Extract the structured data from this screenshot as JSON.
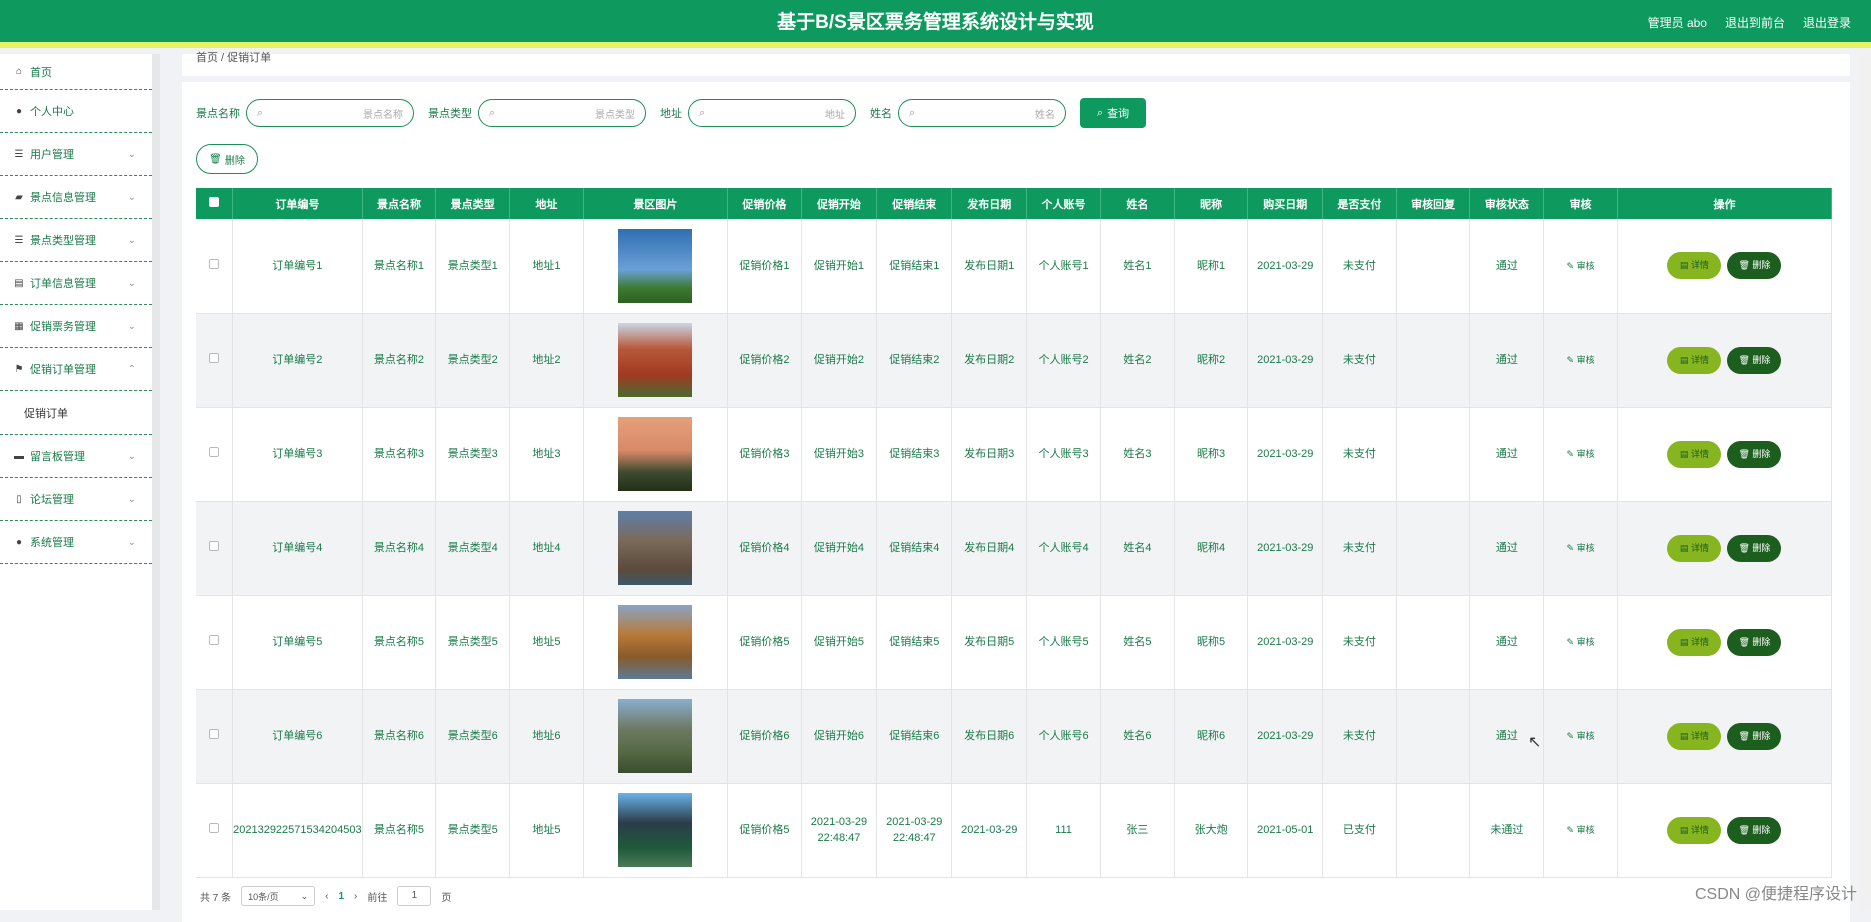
{
  "header": {
    "title": "基于B/S景区票务管理系统设计与实现",
    "admin": "管理员 abo",
    "front": "退出到前台",
    "logout": "退出登录"
  },
  "sidebar": {
    "items": [
      {
        "label": "首页",
        "icon": "home-icon"
      },
      {
        "label": "个人中心",
        "icon": "user-icon"
      },
      {
        "label": "用户管理",
        "icon": "list-icon"
      },
      {
        "label": "景点信息管理",
        "icon": "camera-icon"
      },
      {
        "label": "景点类型管理",
        "icon": "list-icon"
      },
      {
        "label": "订单信息管理",
        "icon": "printer-icon"
      },
      {
        "label": "促销票务管理",
        "icon": "clipboard-icon"
      },
      {
        "label": "促销订单管理",
        "icon": "flag-icon"
      },
      {
        "label": "留言板管理",
        "icon": "monitor-icon"
      },
      {
        "label": "论坛管理",
        "icon": "forum-icon"
      },
      {
        "label": "系统管理",
        "icon": "user-icon"
      }
    ],
    "submenu": "促销订单"
  },
  "breadcrumb": "首页 / 促销订单",
  "search": {
    "fields": [
      {
        "label": "景点名称",
        "placeholder": "景点名称"
      },
      {
        "label": "景点类型",
        "placeholder": "景点类型"
      },
      {
        "label": "地址",
        "placeholder": "地址"
      },
      {
        "label": "姓名",
        "placeholder": "姓名"
      }
    ],
    "query": "查询",
    "delete": "删除"
  },
  "table": {
    "columns": [
      "订单编号",
      "景点名称",
      "景点类型",
      "地址",
      "景区图片",
      "促销价格",
      "促销开始",
      "促销结束",
      "发布日期",
      "个人账号",
      "姓名",
      "昵称",
      "购买日期",
      "是否支付",
      "审核回复",
      "审核状态",
      "审核",
      "操作"
    ],
    "rows": [
      {
        "c0": "订单编号1",
        "c1": "景点名称1",
        "c2": "景点类型1",
        "c3": "地址1",
        "c5": "促销价格1",
        "c6": "促销开始1",
        "c7": "促销结束1",
        "c8": "发布日期1",
        "c9": "个人账号1",
        "c10": "姓名1",
        "c11": "昵称1",
        "c12": "2021-03-29",
        "c13": "未支付",
        "c14": "",
        "c15": "通过"
      },
      {
        "c0": "订单编号2",
        "c1": "景点名称2",
        "c2": "景点类型2",
        "c3": "地址2",
        "c5": "促销价格2",
        "c6": "促销开始2",
        "c7": "促销结束2",
        "c8": "发布日期2",
        "c9": "个人账号2",
        "c10": "姓名2",
        "c11": "昵称2",
        "c12": "2021-03-29",
        "c13": "未支付",
        "c14": "",
        "c15": "通过"
      },
      {
        "c0": "订单编号3",
        "c1": "景点名称3",
        "c2": "景点类型3",
        "c3": "地址3",
        "c5": "促销价格3",
        "c6": "促销开始3",
        "c7": "促销结束3",
        "c8": "发布日期3",
        "c9": "个人账号3",
        "c10": "姓名3",
        "c11": "昵称3",
        "c12": "2021-03-29",
        "c13": "未支付",
        "c14": "",
        "c15": "通过"
      },
      {
        "c0": "订单编号4",
        "c1": "景点名称4",
        "c2": "景点类型4",
        "c3": "地址4",
        "c5": "促销价格4",
        "c6": "促销开始4",
        "c7": "促销结束4",
        "c8": "发布日期4",
        "c9": "个人账号4",
        "c10": "姓名4",
        "c11": "昵称4",
        "c12": "2021-03-29",
        "c13": "未支付",
        "c14": "",
        "c15": "通过"
      },
      {
        "c0": "订单编号5",
        "c1": "景点名称5",
        "c2": "景点类型5",
        "c3": "地址5",
        "c5": "促销价格5",
        "c6": "促销开始5",
        "c7": "促销结束5",
        "c8": "发布日期5",
        "c9": "个人账号5",
        "c10": "姓名5",
        "c11": "昵称5",
        "c12": "2021-03-29",
        "c13": "未支付",
        "c14": "",
        "c15": "通过"
      },
      {
        "c0": "订单编号6",
        "c1": "景点名称6",
        "c2": "景点类型6",
        "c3": "地址6",
        "c5": "促销价格6",
        "c6": "促销开始6",
        "c7": "促销结束6",
        "c8": "发布日期6",
        "c9": "个人账号6",
        "c10": "姓名6",
        "c11": "昵称6",
        "c12": "2021-03-29",
        "c13": "未支付",
        "c14": "",
        "c15": "通过"
      },
      {
        "c0": "202132922571534204503",
        "c1": "景点名称5",
        "c2": "景点类型5",
        "c3": "地址5",
        "c5": "促销价格5",
        "c6": "2021-03-29 22:48:47",
        "c7": "2021-03-29 22:48:47",
        "c8": "2021-03-29",
        "c9": "111",
        "c10": "张三",
        "c11": "张大炮",
        "c12": "2021-05-01",
        "c13": "已支付",
        "c14": "",
        "c15": "未通过"
      }
    ],
    "audit": "审核",
    "detail": "详情",
    "delete": "删除"
  },
  "pager": {
    "total": "共 7 条",
    "size": "10条/页",
    "page": "1",
    "goto": "前往",
    "jump": "1",
    "unit": "页"
  },
  "watermark": "CSDN @便捷程序设计"
}
